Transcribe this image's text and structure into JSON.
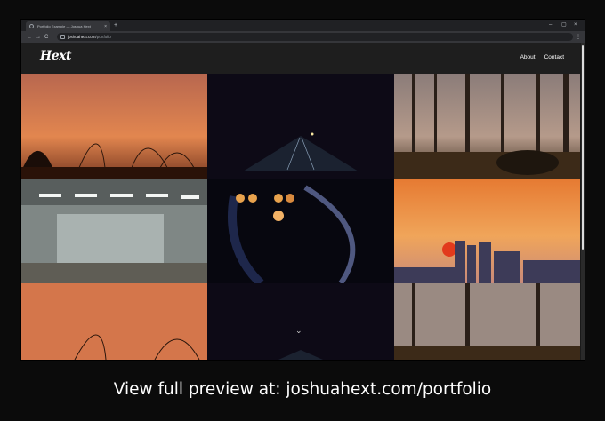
{
  "browser": {
    "tab_title": "Portfolio Example — Joshua Hext",
    "tab_close": "×",
    "new_tab": "+",
    "window_controls": [
      "–",
      "▢",
      "×"
    ],
    "url_domain": "joshuahext.com",
    "url_path": "/portfolio",
    "back": "←",
    "forward": "→",
    "reload": "C",
    "menu": "⋮"
  },
  "site": {
    "logo": "Hext",
    "nav": [
      "About",
      "Contact"
    ]
  },
  "gallery": {
    "scroll_hint": "⌄",
    "photos": [
      {
        "subject": "sunset-grass",
        "sky": "#d4764b"
      },
      {
        "subject": "night-road",
        "sky": "#0d0a16"
      },
      {
        "subject": "forest-dusk",
        "sky": "#9a8a82"
      },
      {
        "subject": "office-interior",
        "sky": "#9aa3a5"
      },
      {
        "subject": "bokeh-lights",
        "sky": "#07070f"
      },
      {
        "subject": "city-sunset",
        "sky": "#e9843e"
      },
      {
        "subject": "sunset-grass",
        "sky": "#d4764b"
      },
      {
        "subject": "night-road",
        "sky": "#0d0a16"
      },
      {
        "subject": "forest-dusk",
        "sky": "#9a8a82"
      }
    ]
  },
  "caption": "View full preview at: joshuahext.com/portfolio"
}
